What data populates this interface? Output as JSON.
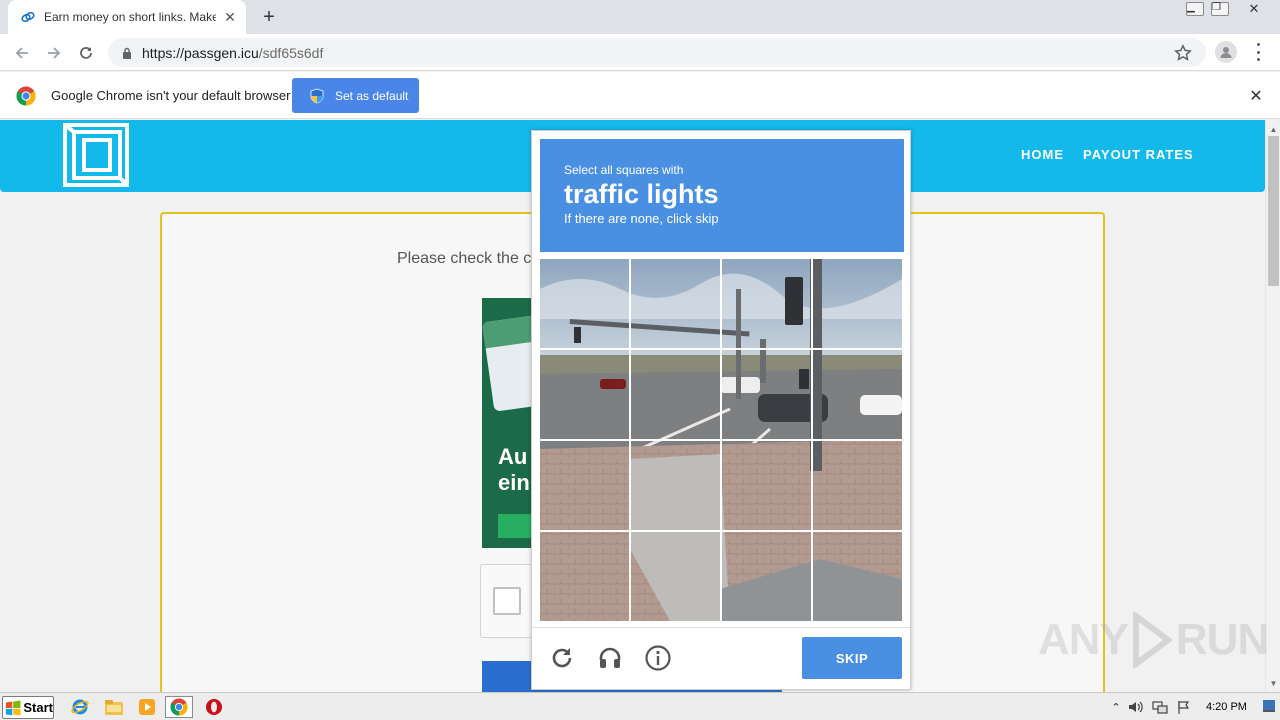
{
  "browser": {
    "tab_title": "Earn money on short links. Make sho",
    "url_host": "https://passgen.icu",
    "url_path": "/sdf65s6df",
    "infobar_text": "Google Chrome isn't your default browser",
    "set_default_label": "Set as default"
  },
  "site": {
    "nav": [
      {
        "label": "HOME"
      },
      {
        "label": "PAYOUT RATES"
      }
    ],
    "please_text": "Please check the c",
    "ad_text": "Au\nein",
    "header_color": "#14b9eb",
    "box_border_color": "#e3c21e"
  },
  "captcha": {
    "instruction_small": "Select all squares with",
    "instruction_target": "traffic lights",
    "instruction_sub": "If there are none, click skip",
    "skip_label": "SKIP",
    "header_color": "#4a90e2",
    "icons": [
      "reload-icon",
      "audio-icon",
      "info-icon"
    ]
  },
  "watermark": {
    "text_left": "ANY",
    "text_right": "RUN"
  },
  "taskbar": {
    "start_label": "Start",
    "clock": "4:20 PM"
  }
}
